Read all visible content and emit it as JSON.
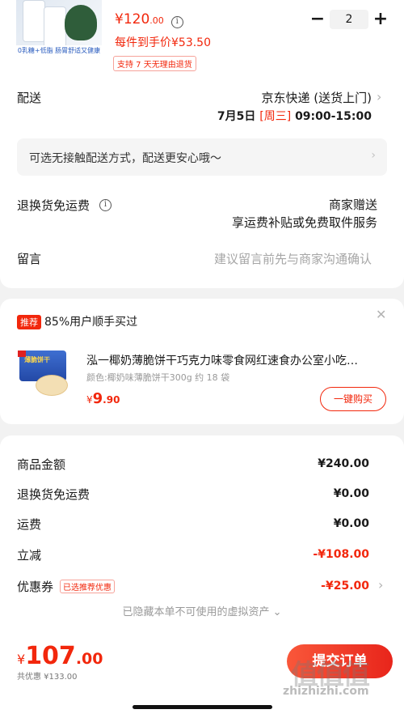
{
  "product": {
    "image_caption": "0乳糖+低脂 肠胃舒适又健康",
    "price_symbol": "¥",
    "price_int": "120",
    "price_dec": ".00",
    "unit_price": "每件到手价¥53.50",
    "return_tag": "支持 7 天无理由退货",
    "quantity": "2",
    "minus": "−",
    "plus": "+"
  },
  "delivery": {
    "label": "配送",
    "method": "京东快递 (送货上门)",
    "date": "7月5日",
    "weekday": "[周三]",
    "time": "09:00-15:00",
    "contactless_text": "可选无接触配送方式，配送更安心哦～"
  },
  "freight_insurance": {
    "label": "退换货免运费",
    "value_line1": "商家赠送",
    "value_line2": "享运费补贴或免费取件服务"
  },
  "message": {
    "label": "留言",
    "placeholder": "建议留言前先与商家沟通确认"
  },
  "recommend": {
    "badge": "推荐",
    "title": "85%用户顺手买过",
    "pack_text": "薄脆饼干",
    "name": "泓一椰奶薄脆饼干巧克力味零食网红速食办公室小吃…",
    "spec": "颜色:椰奶味薄脆饼干300g 约 18 袋",
    "price_symbol": "¥",
    "price_int": "9",
    "price_dec": ".90",
    "buy_button": "一键购买"
  },
  "summary": {
    "rows": [
      {
        "label": "商品金额",
        "value": "¥240.00"
      },
      {
        "label": "退换货免运费",
        "value": "¥0.00"
      },
      {
        "label": "运费",
        "value": "¥0.00"
      },
      {
        "label": "立减",
        "value": "-¥108.00"
      },
      {
        "label": "优惠券",
        "value": "-¥25.00",
        "tag": "已选推荐优惠"
      }
    ],
    "hidden_note": "已隐藏本单不可使用的虚拟资产"
  },
  "bottom": {
    "currency": "¥",
    "total_int": "107",
    "total_dec": ".00",
    "discount_text": "共优惠 ¥133.00",
    "submit_label": "提交订单",
    "watermark_main": "值值值",
    "watermark_url": "zhizhizhi.com"
  },
  "colors": {
    "accent": "#f2270c",
    "page_bg": "#f2f2f2"
  }
}
